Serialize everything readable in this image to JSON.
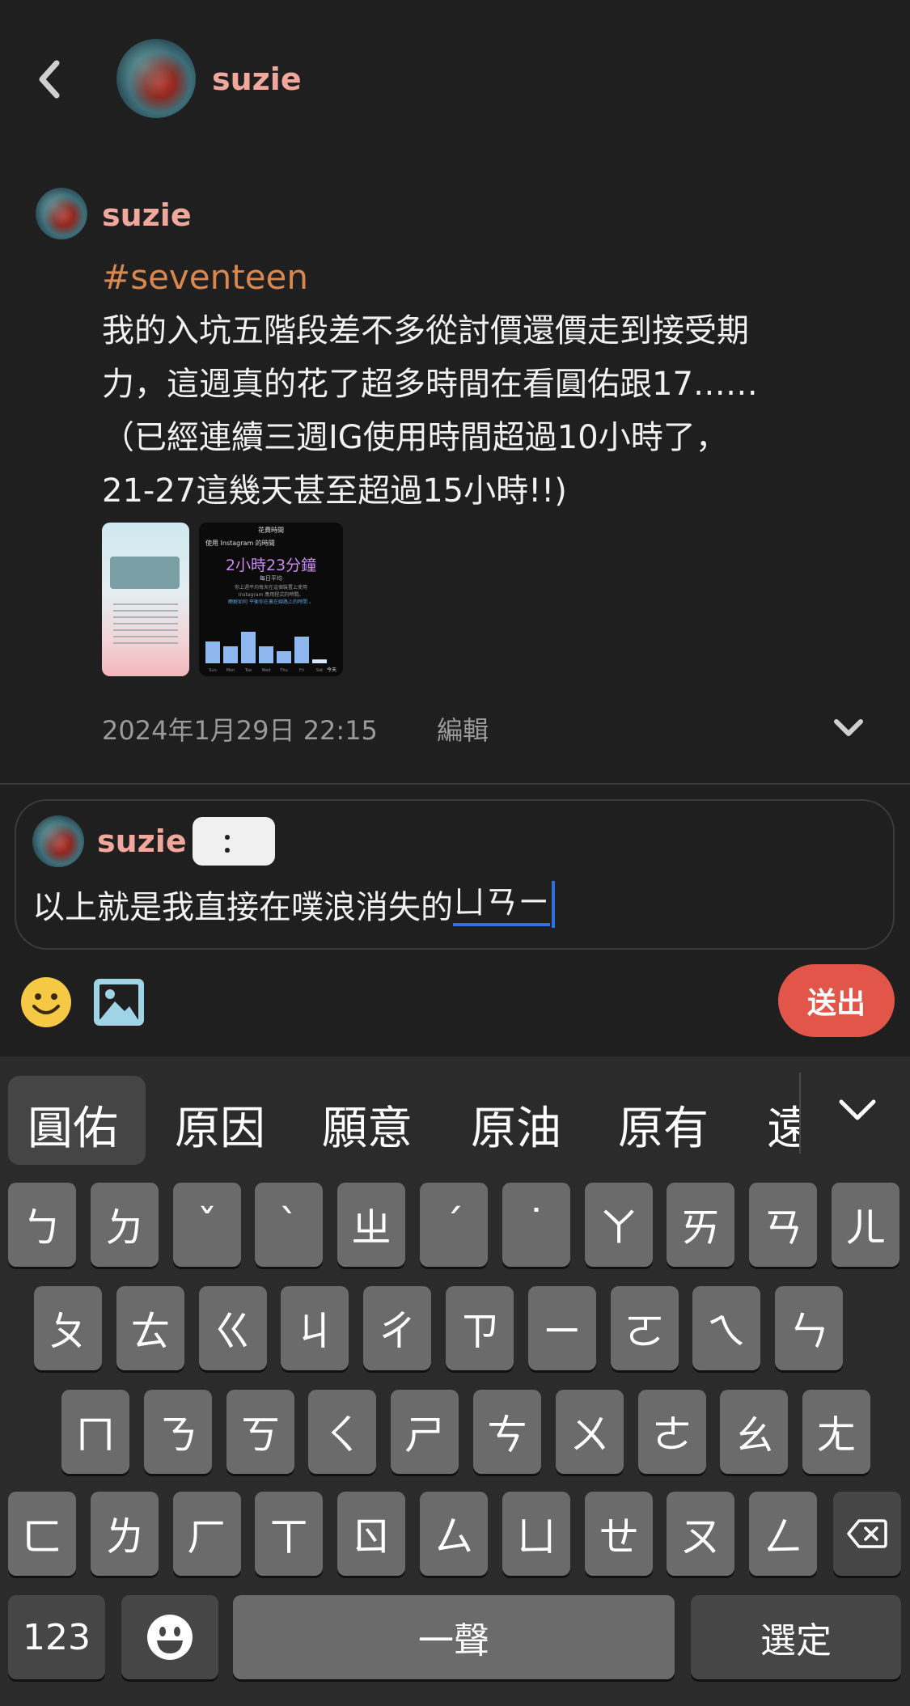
{
  "header": {
    "username": "suzie"
  },
  "post": {
    "username": "suzie",
    "hashtag": "#seventeen",
    "lines": [
      "我的入坑五階段差不多從討價還價走到接受期",
      "力，這週真的花了超多時間在看圓佑跟17……",
      "（已經連續三週IG使用時間超過10小時了，",
      "21-27這幾天甚至超過15小時!!)"
    ],
    "screenshot": {
      "title": "花費時間",
      "subtitle": "使用 Instagram 的時間",
      "big_time": "2小時23分鐘",
      "caption": "每日平均",
      "desc1": "你上週平均每天在這個裝置上使用",
      "desc2": "Instagram 應用程式的時間。",
      "desc3": "瞭解如何 平衡你在裏在線路上的時間 。",
      "days": [
        "Sun",
        "Mon",
        "Tue",
        "Wed",
        "Thu",
        "Fri",
        "Sat"
      ],
      "today": "今天",
      "bar_levels": [
        0.45,
        0.35,
        0.65,
        0.35,
        0.25,
        0.55,
        0.08
      ]
    },
    "timestamp": "2024年1月29日 22:15",
    "edit_label": "編輯"
  },
  "reply": {
    "username": "suzie",
    "qualifier": "：",
    "text": "以上就是我直接在噗浪消失的",
    "composing": "ㄩㄢㄧ",
    "send_label": "送出"
  },
  "keyboard": {
    "candidates": [
      "圓佑",
      "原因",
      "願意",
      "原油",
      "原有",
      "遠"
    ],
    "row1": [
      "ㄅ",
      "ㄉ",
      "ˇ",
      "ˋ",
      "ㄓ",
      "ˊ",
      "˙",
      "ㄚ",
      "ㄞ",
      "ㄢ",
      "ㄦ"
    ],
    "row2": [
      "ㄆ",
      "ㄊ",
      "ㄍ",
      "ㄐ",
      "ㄔ",
      "ㄗ",
      "ㄧ",
      "ㄛ",
      "ㄟ",
      "ㄣ"
    ],
    "row3": [
      "ㄇ",
      "ㄋ",
      "ㄎ",
      "ㄑ",
      "ㄕ",
      "ㄘ",
      "ㄨ",
      "ㄜ",
      "ㄠ",
      "ㄤ"
    ],
    "row4": [
      "ㄈ",
      "ㄌ",
      "ㄏ",
      "ㄒ",
      "ㄖ",
      "ㄙ",
      "ㄩ",
      "ㄝ",
      "ㄡ",
      "ㄥ"
    ],
    "numbers_label": "123",
    "space_label": "一聲",
    "select_label": "選定"
  },
  "colors": {
    "background": "#1f1f1f",
    "username": "#f0a89c",
    "hashtag": "#d9874f",
    "send_button": "#e2564a",
    "composing_underline": "#2f6fe0",
    "key": "#6b6b6b",
    "key_dark": "#464646"
  }
}
